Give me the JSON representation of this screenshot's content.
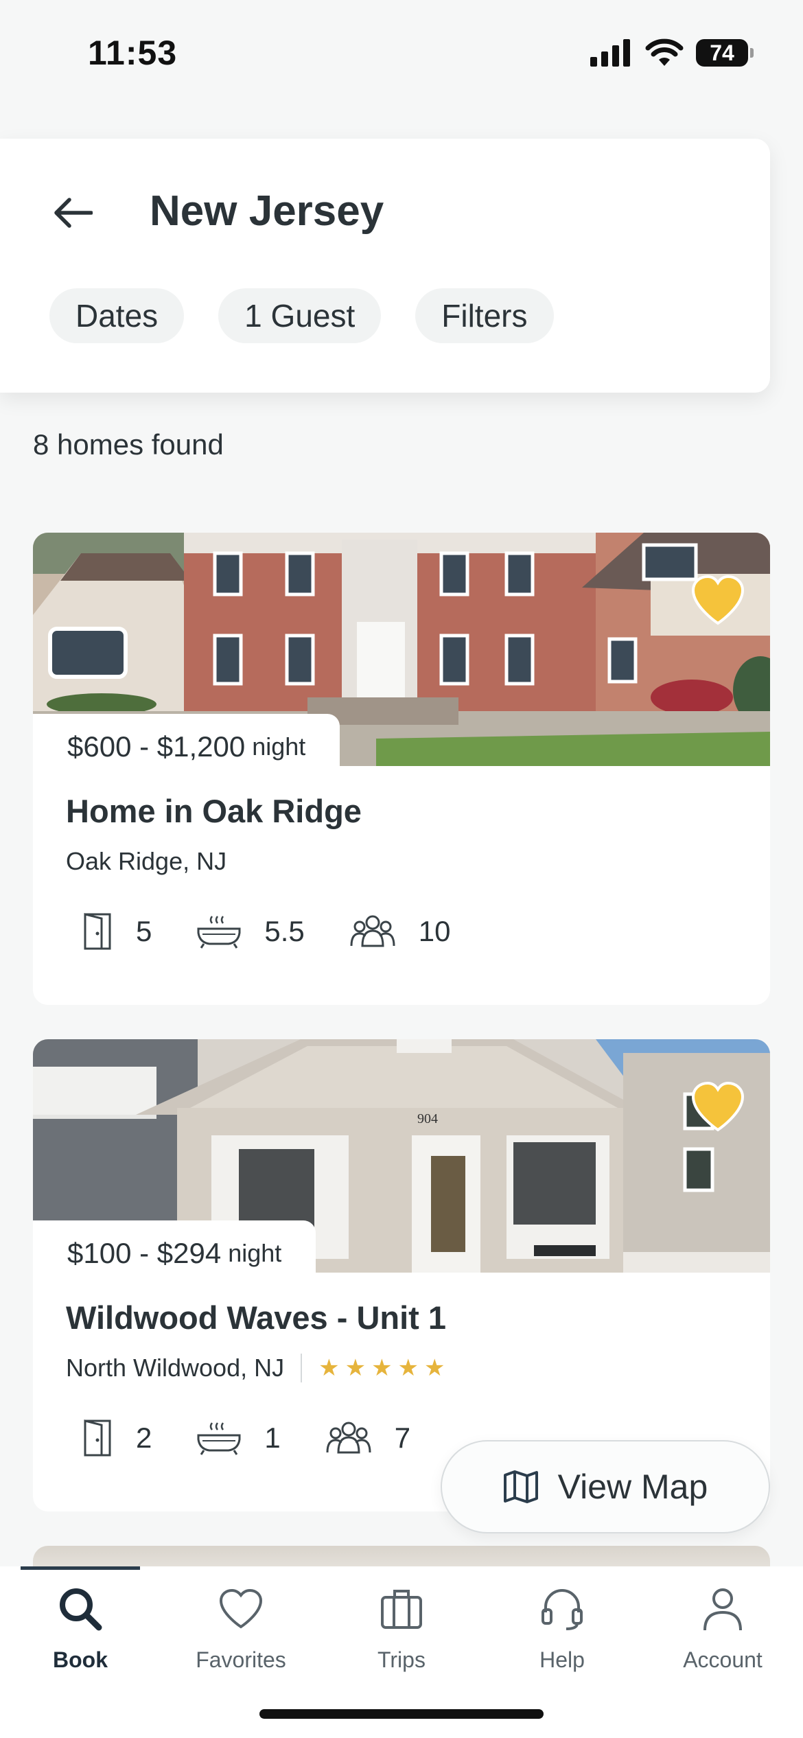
{
  "status_bar": {
    "time": "11:53",
    "battery": "74"
  },
  "header": {
    "title": "New Jersey",
    "chips": [
      "Dates",
      "1 Guest",
      "Filters"
    ]
  },
  "results": {
    "count_text": "8 homes found"
  },
  "listings": [
    {
      "price_range": "$600 - $1,200",
      "price_unit": "night",
      "name": "Home in Oak Ridge",
      "location": "Oak Ridge, NJ",
      "rating_stars": 0,
      "bedrooms": "5",
      "bathrooms": "5.5",
      "guests": "10",
      "favorited": true
    },
    {
      "price_range": "$100 - $294",
      "price_unit": "night",
      "name": "Wildwood Waves - Unit 1",
      "location": "North Wildwood, NJ",
      "rating_stars": 5,
      "bedrooms": "2",
      "bathrooms": "1",
      "guests": "7",
      "favorited": true
    }
  ],
  "map_button": {
    "label": "View Map"
  },
  "tabs": [
    {
      "label": "Book",
      "icon": "search-icon",
      "active": true
    },
    {
      "label": "Favorites",
      "icon": "heart-icon",
      "active": false
    },
    {
      "label": "Trips",
      "icon": "suitcase-icon",
      "active": false
    },
    {
      "label": "Help",
      "icon": "headset-icon",
      "active": false
    },
    {
      "label": "Account",
      "icon": "person-icon",
      "active": false
    }
  ],
  "colors": {
    "accent": "#f5c33b",
    "text": "#2b3338",
    "active_tab": "#1f2d3a"
  }
}
